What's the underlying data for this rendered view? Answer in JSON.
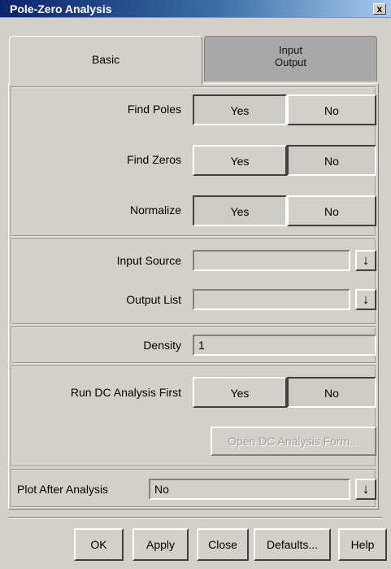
{
  "window": {
    "title": "Pole-Zero Analysis",
    "close_glyph": "x"
  },
  "tabs": [
    {
      "label": "Basic",
      "selected": true
    },
    {
      "label": "Input\nOutput",
      "selected": false
    }
  ],
  "basic": {
    "find_poles": {
      "label": "Find Poles",
      "yes": "Yes",
      "no": "No",
      "value": "Yes"
    },
    "find_zeros": {
      "label": "Find Zeros",
      "yes": "Yes",
      "no": "No",
      "value": "No"
    },
    "normalize": {
      "label": "Normalize",
      "yes": "Yes",
      "no": "No",
      "value": "Yes"
    },
    "input_source": {
      "label": "Input Source",
      "value": ""
    },
    "output_list": {
      "label": "Output List",
      "value": ""
    },
    "density": {
      "label": "Density",
      "value": "1"
    },
    "run_dc": {
      "label": "Run DC Analysis First",
      "yes": "Yes",
      "no": "No",
      "value": "No"
    },
    "open_dc_form": "Open DC Analysis Form...",
    "plot_after": {
      "label": "Plot After Analysis",
      "value": "No"
    }
  },
  "icons": {
    "dropdown": "down-arrow-icon",
    "glyph": "↓"
  },
  "buttons": {
    "ok": "OK",
    "apply": "Apply",
    "close": "Close",
    "defaults": "Defaults...",
    "help": "Help"
  }
}
